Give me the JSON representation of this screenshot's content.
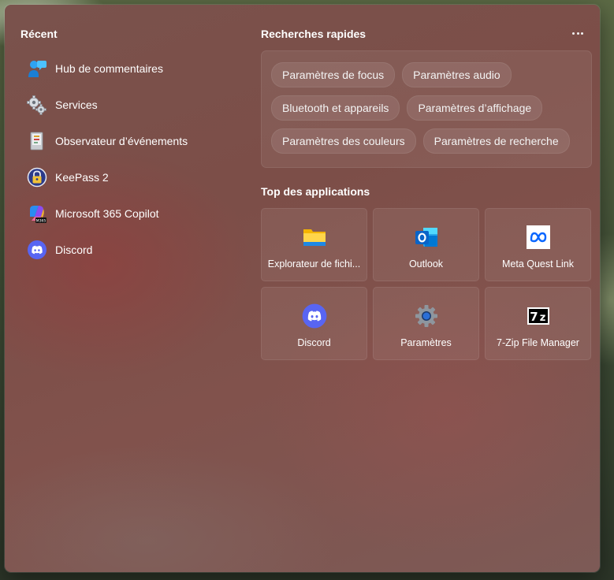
{
  "recent": {
    "title": "Récent",
    "items": [
      {
        "label": "Hub de commentaires",
        "icon": "feedback-hub-icon"
      },
      {
        "label": "Services",
        "icon": "services-gears-icon"
      },
      {
        "label": "Observateur d’événements",
        "icon": "event-viewer-icon"
      },
      {
        "label": "KeePass 2",
        "icon": "keepass-icon"
      },
      {
        "label": "Microsoft 365 Copilot",
        "icon": "microsoft-365-copilot-icon"
      },
      {
        "label": "Discord",
        "icon": "discord-icon"
      }
    ]
  },
  "quick_search": {
    "title": "Recherches rapides",
    "more_label": "…",
    "pills": [
      [
        "Paramètres de focus",
        "Paramètres audio"
      ],
      [
        "Bluetooth et appareils",
        "Paramètres d’affichage"
      ],
      [
        "Paramètres des couleurs",
        "Paramètres de recherche"
      ]
    ]
  },
  "top_apps": {
    "title": "Top des applications",
    "apps": [
      {
        "label": "Explorateur de fichi...",
        "icon": "file-explorer-icon"
      },
      {
        "label": "Outlook",
        "icon": "outlook-icon"
      },
      {
        "label": "Meta Quest Link",
        "icon": "meta-icon"
      },
      {
        "label": "Discord",
        "icon": "discord-icon"
      },
      {
        "label": "Paramètres",
        "icon": "settings-gear-icon"
      },
      {
        "label": "7-Zip File Manager",
        "icon": "7zip-icon"
      }
    ]
  },
  "colors": {
    "panel": "#7c4f49",
    "discord": "#5865f2",
    "outlook": "#0a64c8",
    "meta": "#0866ff"
  }
}
